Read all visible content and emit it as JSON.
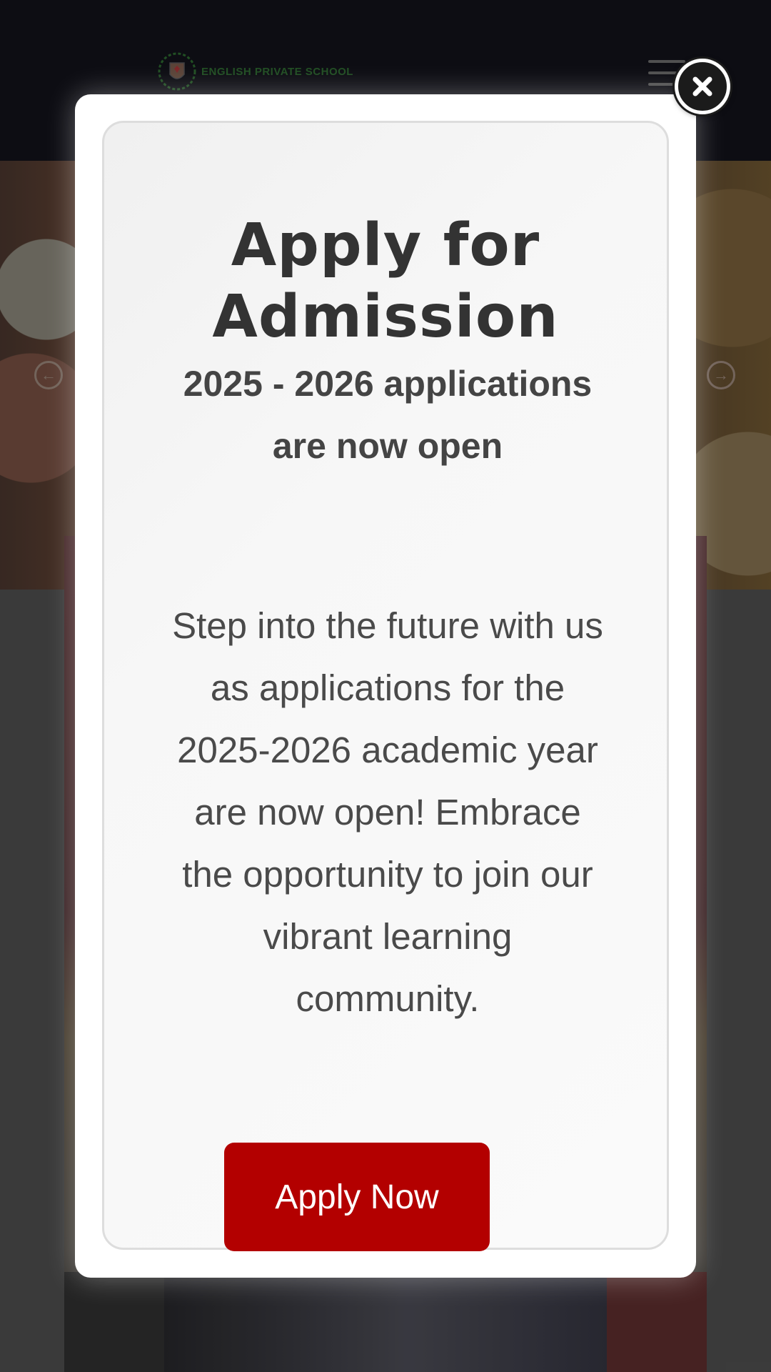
{
  "site": {
    "logo_text": "ENGLISH PRIVATE SCHOOL",
    "menu_icon": "hamburger-menu-icon",
    "slider_prev_icon": "arrow-left-circle-icon",
    "slider_next_icon": "arrow-right-circle-icon"
  },
  "modal": {
    "title": "Apply for Admission",
    "subtitle": "2025 - 2026 applications are now open",
    "body": "Step into the future with us as applications for the 2025-2026 academic year are now open! Embrace the opportunity to join our vibrant learning community.",
    "cta_label": "Apply Now",
    "close_icon": "close-icon"
  },
  "colors": {
    "cta_background": "#b30000",
    "cta_text": "#ffffff",
    "title_text": "#333333",
    "header_background": "#0e0e15"
  }
}
